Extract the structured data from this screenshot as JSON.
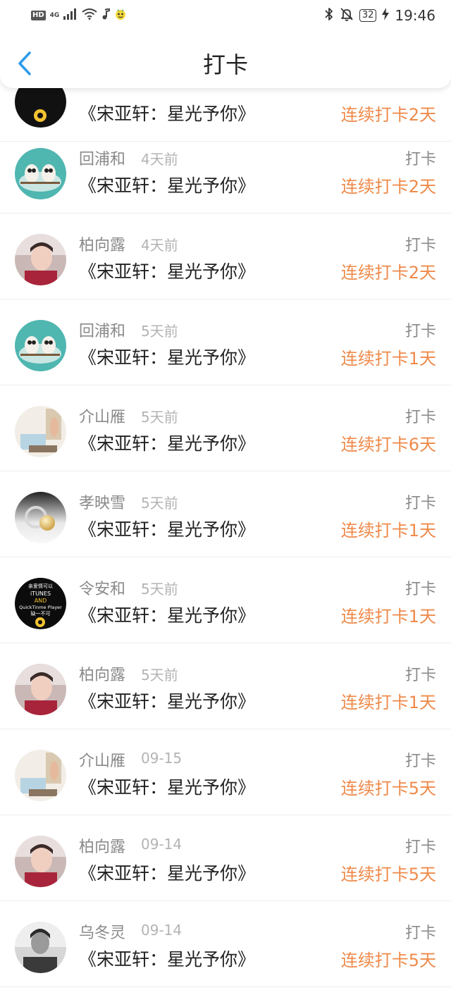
{
  "status_bar": {
    "hd_label": "HD",
    "network_label": "4G",
    "battery_level": "32",
    "time": "19:46"
  },
  "header": {
    "title": "打卡",
    "back_icon": "chevron-left-icon"
  },
  "colors": {
    "accent_blue": "#2f9bea",
    "streak_orange": "#ef8a4a",
    "name_gray": "#8a8a8a",
    "time_gray": "#b3b3b3"
  },
  "checkins": [
    {
      "name": "",
      "time": "",
      "action": "",
      "book": "《宋亚轩：星光予你》",
      "streak": "连续打卡2天",
      "avatar": "itunes-poster"
    },
    {
      "name": "回浦和",
      "time": "4天前",
      "action": "打卡",
      "book": "《宋亚轩：星光予你》",
      "streak": "连续打卡2天",
      "avatar": "owls"
    },
    {
      "name": "柏向露",
      "time": "4天前",
      "action": "打卡",
      "book": "《宋亚轩：星光予你》",
      "streak": "连续打卡2天",
      "avatar": "selfie"
    },
    {
      "name": "回浦和",
      "time": "5天前",
      "action": "打卡",
      "book": "《宋亚轩：星光予你》",
      "streak": "连续打卡1天",
      "avatar": "owls"
    },
    {
      "name": "介山雁",
      "time": "5天前",
      "action": "打卡",
      "book": "《宋亚轩：星光予你》",
      "streak": "连续打卡6天",
      "avatar": "room"
    },
    {
      "name": "孝映雪",
      "time": "5天前",
      "action": "打卡",
      "book": "《宋亚轩：星光予你》",
      "streak": "连续打卡1天",
      "avatar": "pearl"
    },
    {
      "name": "令安和",
      "time": "5天前",
      "action": "打卡",
      "book": "《宋亚轩：星光予你》",
      "streak": "连续打卡1天",
      "avatar": "itunes-poster"
    },
    {
      "name": "柏向露",
      "time": "5天前",
      "action": "打卡",
      "book": "《宋亚轩：星光予你》",
      "streak": "连续打卡1天",
      "avatar": "selfie"
    },
    {
      "name": "介山雁",
      "time": "09-15",
      "action": "打卡",
      "book": "《宋亚轩：星光予你》",
      "streak": "连续打卡5天",
      "avatar": "room"
    },
    {
      "name": "柏向露",
      "time": "09-14",
      "action": "打卡",
      "book": "《宋亚轩：星光予你》",
      "streak": "连续打卡5天",
      "avatar": "selfie"
    },
    {
      "name": "乌冬灵",
      "time": "09-14",
      "action": "打卡",
      "book": "《宋亚轩：星光予你》",
      "streak": "连续打卡5天",
      "avatar": "bw-portrait"
    }
  ],
  "avatar_texts": {
    "poster_line1": "亲爱情可以",
    "poster_line2": "iTUNES",
    "poster_line3": "AND",
    "poster_line4": "QuickTinme Player",
    "poster_line5": "缺一不可"
  }
}
